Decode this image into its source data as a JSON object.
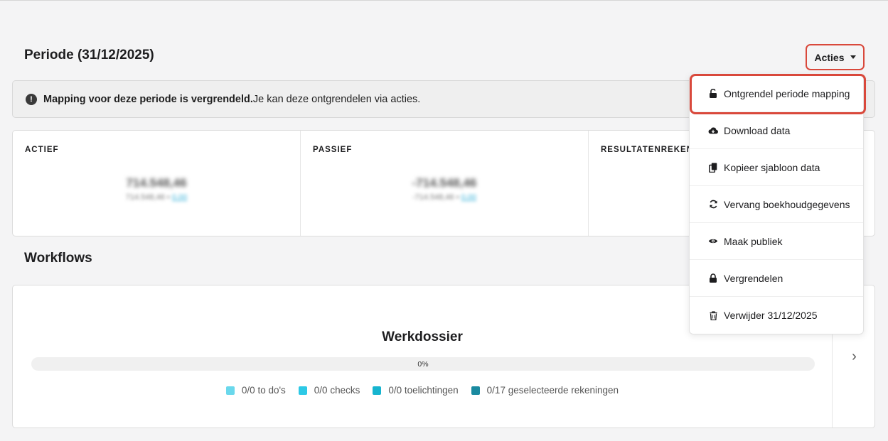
{
  "header": {
    "title": "Periode (31/12/2025)",
    "actions_label": "Acties"
  },
  "alert": {
    "bold_text": "Mapping voor deze periode is vergrendeld.",
    "text": "Je kan deze ontgrendelen via acties."
  },
  "stats": [
    {
      "label": "ACTIEF",
      "value": "714.548,46",
      "sub": "714.548,46 •",
      "sub_link": "0,00"
    },
    {
      "label": "PASSIEF",
      "value": "-714.548,46",
      "sub": "-714.548,46 •",
      "sub_link": "0,00"
    },
    {
      "label": "RESULTATENREKENI"
    }
  ],
  "workflows": {
    "title": "Workflows",
    "card": {
      "name": "Werkdossier",
      "progress_label": "0%",
      "progress_value": 0,
      "legend": [
        {
          "label": "0/0 to do's",
          "color": "#6ad8ec"
        },
        {
          "label": "0/0 checks",
          "color": "#2dc9e6"
        },
        {
          "label": "0/0 toelichtingen",
          "color": "#16b4cf"
        },
        {
          "label": "0/17 geselecteerde rekeningen",
          "color": "#1a8aa0"
        }
      ]
    }
  },
  "dropdown": {
    "items": [
      {
        "label": "Ontgrendel periode mapping",
        "icon": "unlock-icon"
      },
      {
        "label": "Download data",
        "icon": "cloud-download-icon"
      },
      {
        "label": "Kopieer sjabloon data",
        "icon": "copy-icon"
      },
      {
        "label": "Vervang boekhoudgegevens",
        "icon": "sync-icon"
      },
      {
        "label": "Maak publiek",
        "icon": "eye-icon"
      },
      {
        "label": "Vergrendelen",
        "icon": "lock-icon"
      },
      {
        "label": "Verwijder 31/12/2025",
        "icon": "trash-icon"
      }
    ]
  },
  "colors": {
    "highlight": "#d9483b",
    "link": "#35b0d8"
  }
}
